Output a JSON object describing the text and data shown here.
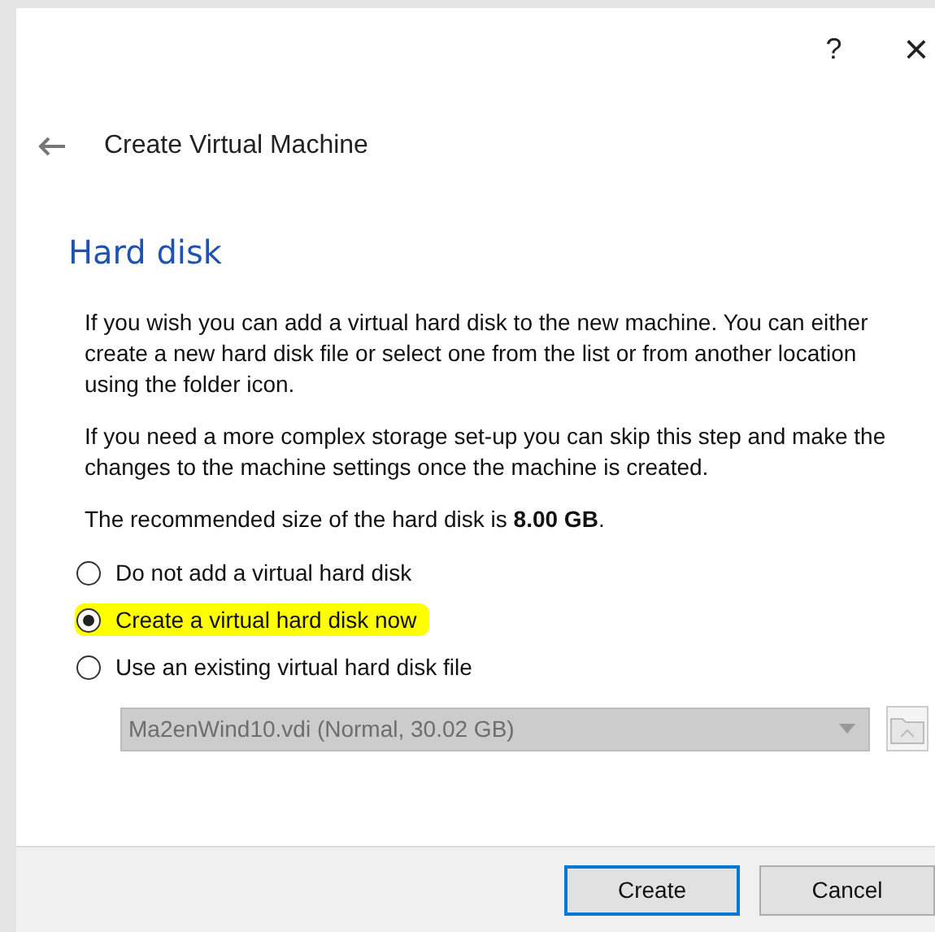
{
  "window": {
    "help": "?",
    "close": "×"
  },
  "header": {
    "title": "Create Virtual Machine"
  },
  "page": {
    "heading": "Hard disk",
    "paragraphs": [
      "If you wish you can add a virtual hard disk to the new machine. You can either create a new hard disk file or select one from the list or from another location using the folder icon.",
      "If you need a more complex storage set-up you can skip this step and make the changes to the machine settings once the machine is created.",
      "The recommended size of the hard disk is **8.00 GB**."
    ],
    "options": [
      {
        "label": "Do not add a virtual hard disk",
        "selected": false,
        "highlighted": false
      },
      {
        "label": "Create a virtual hard disk now",
        "selected": true,
        "highlighted": true
      },
      {
        "label": "Use an existing virtual hard disk file",
        "selected": false,
        "highlighted": false
      }
    ],
    "disk_select": {
      "value": "Ma2enWind10.vdi (Normal, 30.02 GB)",
      "disabled": true
    }
  },
  "buttons": [
    {
      "label": "Create",
      "default": true
    },
    {
      "label": "Cancel",
      "default": false
    }
  ]
}
